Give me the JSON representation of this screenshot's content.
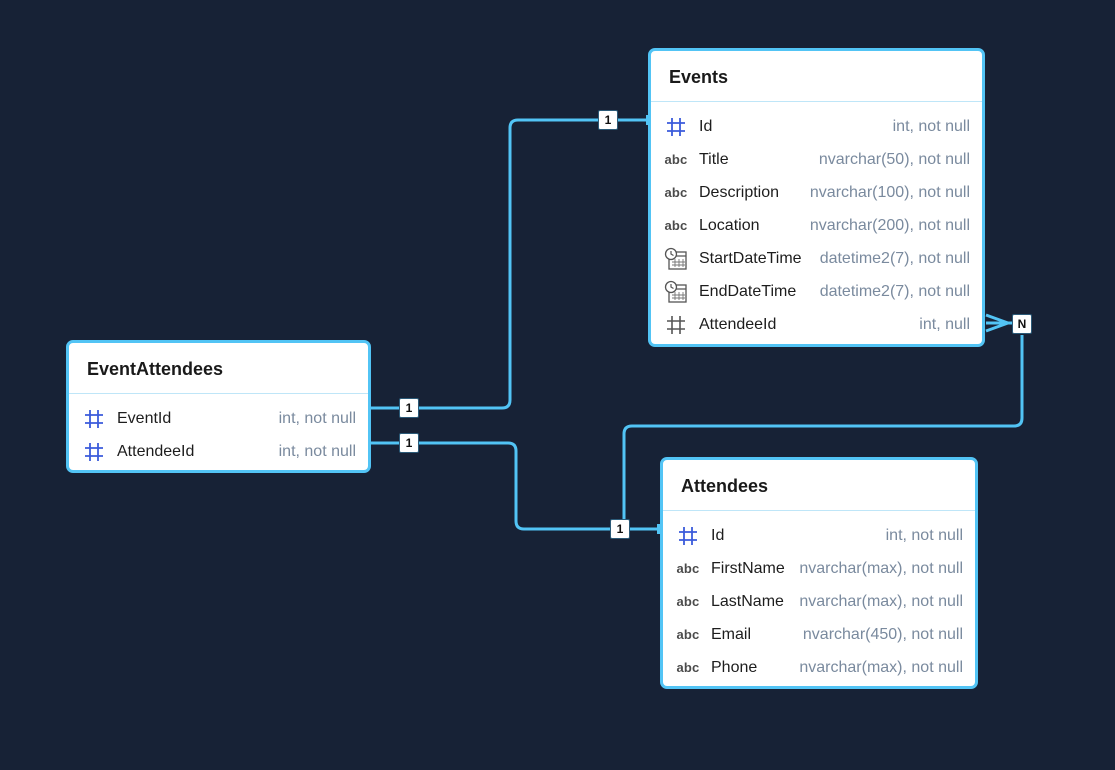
{
  "tables": {
    "events": {
      "title": "Events",
      "columns": [
        {
          "name": "Id",
          "type": "int, not null",
          "icon": "hash-key-icon"
        },
        {
          "name": "Title",
          "type": "nvarchar(50), not null",
          "icon": "text-abc-icon"
        },
        {
          "name": "Description",
          "type": "nvarchar(100), not null",
          "icon": "text-abc-icon"
        },
        {
          "name": "Location",
          "type": "nvarchar(200), not null",
          "icon": "text-abc-icon"
        },
        {
          "name": "StartDateTime",
          "type": "datetime2(7), not null",
          "icon": "datetime-icon"
        },
        {
          "name": "EndDateTime",
          "type": "datetime2(7), not null",
          "icon": "datetime-icon"
        },
        {
          "name": "AttendeeId",
          "type": "int, null",
          "icon": "hash-icon"
        }
      ]
    },
    "event_attendees": {
      "title": "EventAttendees",
      "columns": [
        {
          "name": "EventId",
          "type": "int, not null",
          "icon": "hash-key-icon"
        },
        {
          "name": "AttendeeId",
          "type": "int, not null",
          "icon": "hash-key-icon"
        }
      ]
    },
    "attendees": {
      "title": "Attendees",
      "columns": [
        {
          "name": "Id",
          "type": "int, not null",
          "icon": "hash-key-icon"
        },
        {
          "name": "FirstName",
          "type": "nvarchar(max), not null",
          "icon": "text-abc-icon"
        },
        {
          "name": "LastName",
          "type": "nvarchar(max), not null",
          "icon": "text-abc-icon"
        },
        {
          "name": "Email",
          "type": "nvarchar(450), not null",
          "icon": "text-abc-icon"
        },
        {
          "name": "Phone",
          "type": "nvarchar(max), not null",
          "icon": "text-abc-icon"
        }
      ]
    }
  },
  "relationships": [
    {
      "from": "EventAttendees.EventId",
      "to": "Events.Id",
      "from_label": "1",
      "to_label": "1"
    },
    {
      "from": "EventAttendees.AttendeeId",
      "to": "Attendees.Id",
      "from_label": "1",
      "to_label": "1"
    },
    {
      "from": "Attendees.Id",
      "to": "Events.AttendeeId",
      "from_label": "1",
      "to_label": "N"
    }
  ],
  "colors": {
    "background": "#172236",
    "connector": "#52c4f5",
    "key_icon": "#3b5bdb",
    "type_text": "#7a8a9e"
  }
}
